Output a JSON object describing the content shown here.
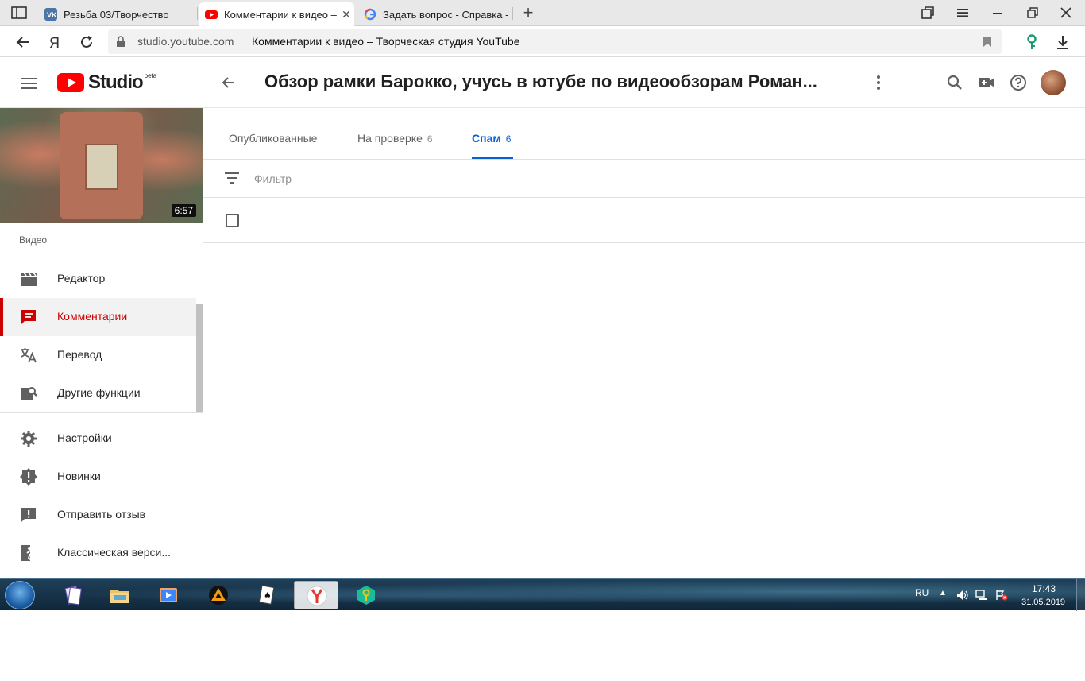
{
  "browser": {
    "tabs": [
      {
        "title": "Резьба 03/Творчество",
        "icon": "vk-icon",
        "active": false
      },
      {
        "title": "Комментарии к видео –",
        "icon": "youtube-icon",
        "active": true
      },
      {
        "title": "Задать вопрос - Справка -",
        "icon": "google-icon",
        "active": false
      }
    ],
    "address": {
      "host": "studio.youtube.com",
      "page_title": "Комментарии к видео – Творческая студия YouTube"
    }
  },
  "header": {
    "logo_text": "Studio",
    "logo_badge": "beta",
    "video_title": "Обзор рамки Барокко, учусь в ютубе по видеообзорам Роман..."
  },
  "sidebar": {
    "video_duration": "6:57",
    "section_label": "Видео",
    "items": [
      {
        "label": "Редактор",
        "icon": "clapperboard-icon",
        "active": false
      },
      {
        "label": "Комментарии",
        "icon": "comment-icon",
        "active": true
      },
      {
        "label": "Перевод",
        "icon": "translate-icon",
        "active": false
      },
      {
        "label": "Другие функции",
        "icon": "more-features-icon",
        "active": false
      }
    ],
    "items_bottom": [
      {
        "label": "Настройки",
        "icon": "gear-icon"
      },
      {
        "label": "Новинки",
        "icon": "alert-badge-icon"
      },
      {
        "label": "Отправить отзыв",
        "icon": "feedback-icon"
      },
      {
        "label": "Классическая верси...",
        "icon": "classic-exit-icon"
      }
    ]
  },
  "content": {
    "tabs": [
      {
        "label": "Опубликованные",
        "count": ""
      },
      {
        "label": "На проверке",
        "count": "6"
      },
      {
        "label": "Спам",
        "count": "6",
        "active": true
      }
    ],
    "filter_placeholder": "Фильтр"
  },
  "taskbar": {
    "language": "RU",
    "time": "17:43",
    "date": "31.05.2019"
  },
  "colors": {
    "accent_red": "#cc0000",
    "accent_blue": "#065fd4",
    "youtube_red": "#ff0000"
  }
}
